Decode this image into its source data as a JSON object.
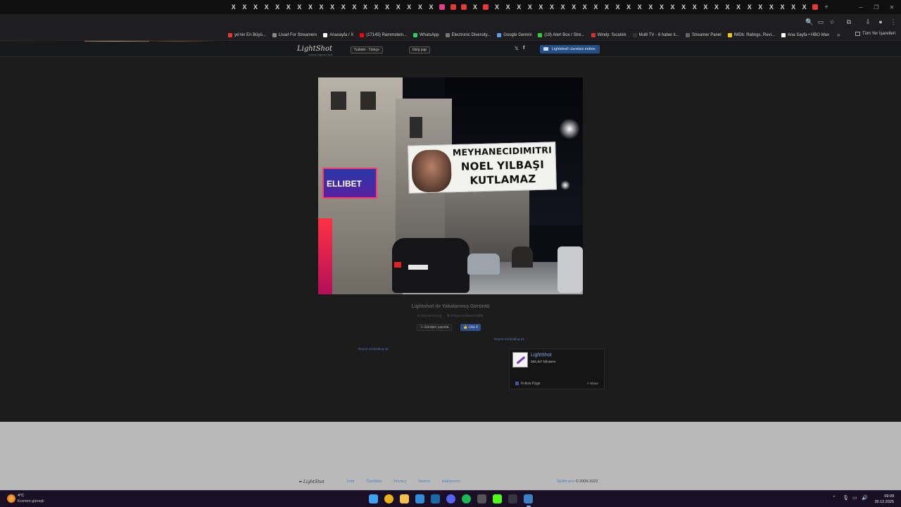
{
  "browser": {
    "tab_close_glyph": "X",
    "new_tab_glyph": "+",
    "bookmarks": [
      {
        "label": "ye'nin En Büyü...",
        "color": "#e33"
      },
      {
        "label": "Livad For Streamers",
        "color": "#888"
      },
      {
        "label": "Anasayfa / X",
        "color": "#fff"
      },
      {
        "label": "(17145) Rammstein...",
        "color": "#f00"
      },
      {
        "label": "WhatsApp",
        "color": "#25d366"
      },
      {
        "label": "Electronic Diversity...",
        "color": "#777"
      },
      {
        "label": "Google Gemini",
        "color": "#5b9cf0"
      },
      {
        "label": "(19) Alert Box / Stre...",
        "color": "#3c3"
      },
      {
        "label": "Windy: Sıcaklık",
        "color": "#c33"
      },
      {
        "label": "Multi TV - 6 haber k...",
        "color": "#333"
      },
      {
        "label": "Streamer Panel",
        "color": "#666"
      },
      {
        "label": "IMDb: Ratings, Revi...",
        "color": "#f5c518"
      },
      {
        "label": "Ana Sayfa • HBO Max",
        "color": "#fff"
      }
    ],
    "bookmarks_more": "»",
    "all_bookmarks": "Tüm Yer İşaretleri"
  },
  "lightshot": {
    "logo": "LightShot",
    "tagline": "screen capture tool",
    "language": "Turkish - Türkçe",
    "login": "Giriş yap",
    "twitter_glyph": "𝕏",
    "facebook_glyph": "f",
    "download_button": "Lightshot'ı ücretsiz indirin",
    "image": {
      "banner_line1": "MEYHANECIDIMITRI",
      "banner_line2": "NOEL YILBAŞI",
      "banner_line3": "KUTLAMAZ",
      "neon_sign": "ELLIBET"
    },
    "caption": "Lightshot ile Yakalanmış Görüntü",
    "meta_left": "✉ benzerini bul",
    "meta_right": "⚑ kötüye kullanım bildir",
    "share_twitter": "𝕏 Gönderi yayınla",
    "share_facebook": "👍 Like 0",
    "report_left": "Report misleading ad",
    "report_right": "Report misleading ad",
    "fb_widget": {
      "name": "LightShot",
      "followers": "383,467 followers",
      "follow": "Follow Page",
      "share": "↗ Share"
    },
    "footer": {
      "logo": "✒ LightShot",
      "links": [
        "İndir",
        "Özellikler",
        "Privacy",
        "Yardım",
        "Haklarımız"
      ],
      "copy_brand": "Skillbrains",
      "copy_rest": " © 2009-2022"
    }
  },
  "taskbar": {
    "temp": "4°C",
    "weather": "Kısmen güneşli",
    "time": "09:09",
    "date": "20.12.2025",
    "apps": [
      {
        "name": "start",
        "color": "#3fa3f5"
      },
      {
        "name": "chrome",
        "color": "#e9b21c"
      },
      {
        "name": "explorer",
        "color": "#f2c14a"
      },
      {
        "name": "edge",
        "color": "#2d8fd8"
      },
      {
        "name": "steam",
        "color": "#1b6aa8"
      },
      {
        "name": "discord",
        "color": "#5865f2"
      },
      {
        "name": "spotify",
        "color": "#1db954"
      },
      {
        "name": "calculator",
        "color": "#555"
      },
      {
        "name": "kick",
        "color": "#53fc18"
      },
      {
        "name": "obs",
        "color": "#36363f"
      },
      {
        "name": "stream-tool",
        "color": "#3b82c4"
      },
      {
        "name": "chrome-active",
        "color": "#c0392b"
      }
    ]
  }
}
